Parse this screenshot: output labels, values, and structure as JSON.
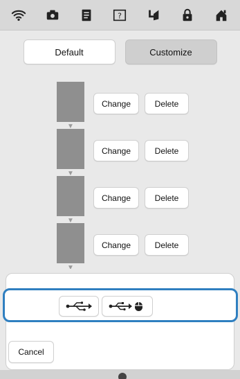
{
  "toolbar": {
    "icons": [
      "wifi-icon",
      "camera-icon",
      "document-icon",
      "help-icon",
      "thread-icon",
      "lock-icon",
      "home-icon"
    ]
  },
  "mode_buttons": {
    "default_label": "Default",
    "customize_label": "Customize",
    "selected": "customize"
  },
  "steps": [
    {
      "change_label": "Change",
      "delete_label": "Delete"
    },
    {
      "change_label": "Change",
      "delete_label": "Delete"
    },
    {
      "change_label": "Change",
      "delete_label": "Delete"
    },
    {
      "change_label": "Change",
      "delete_label": "Delete"
    }
  ],
  "dialog": {
    "usb_buttons": [
      "usb-icon",
      "usb-mouse-icon"
    ],
    "cancel_label": "Cancel"
  },
  "colors": {
    "accent": "#2f7fc0",
    "swatch": "#8f8f8f"
  }
}
